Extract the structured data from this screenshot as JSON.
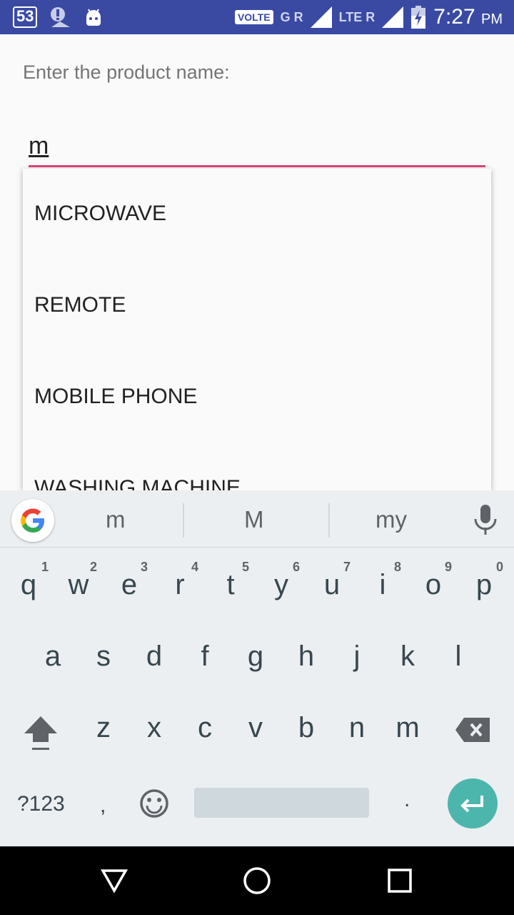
{
  "status_bar": {
    "notification_badge": "53",
    "volte_label": "VOLTE",
    "sim1_label": "G R",
    "sim2_label": "LTE R",
    "time": "7:27",
    "ampm": "PM",
    "icons": [
      "notification-count-icon",
      "warning-drive-icon",
      "android-icon",
      "signal-icon",
      "signal-icon",
      "battery-charging-icon"
    ]
  },
  "form": {
    "prompt_label": "Enter the product name:",
    "input_value": "m"
  },
  "dropdown": {
    "items": [
      {
        "label": "MICROWAVE"
      },
      {
        "label": "REMOTE"
      },
      {
        "label": "MOBILE PHONE"
      },
      {
        "label": "WASHING MACHINE"
      }
    ]
  },
  "keyboard": {
    "suggestions": [
      "m",
      "M",
      "my"
    ],
    "row1": [
      "q",
      "w",
      "e",
      "r",
      "t",
      "y",
      "u",
      "i",
      "o",
      "p"
    ],
    "row1_numbers": [
      "1",
      "2",
      "3",
      "4",
      "5",
      "6",
      "7",
      "8",
      "9",
      "0"
    ],
    "row2": [
      "a",
      "s",
      "d",
      "f",
      "g",
      "h",
      "j",
      "k",
      "l"
    ],
    "row3": [
      "z",
      "x",
      "c",
      "v",
      "b",
      "n",
      "m"
    ],
    "symbols_label": "?123",
    "comma_label": ",",
    "period_label": ".",
    "accent_color": "#4db6ac"
  },
  "nav": {
    "icons": [
      "back-icon",
      "home-icon",
      "recents-icon"
    ]
  },
  "colors": {
    "status_bar": "#3a4aa3",
    "input_underline": "#e0457b",
    "enter_key": "#4db6ac"
  }
}
